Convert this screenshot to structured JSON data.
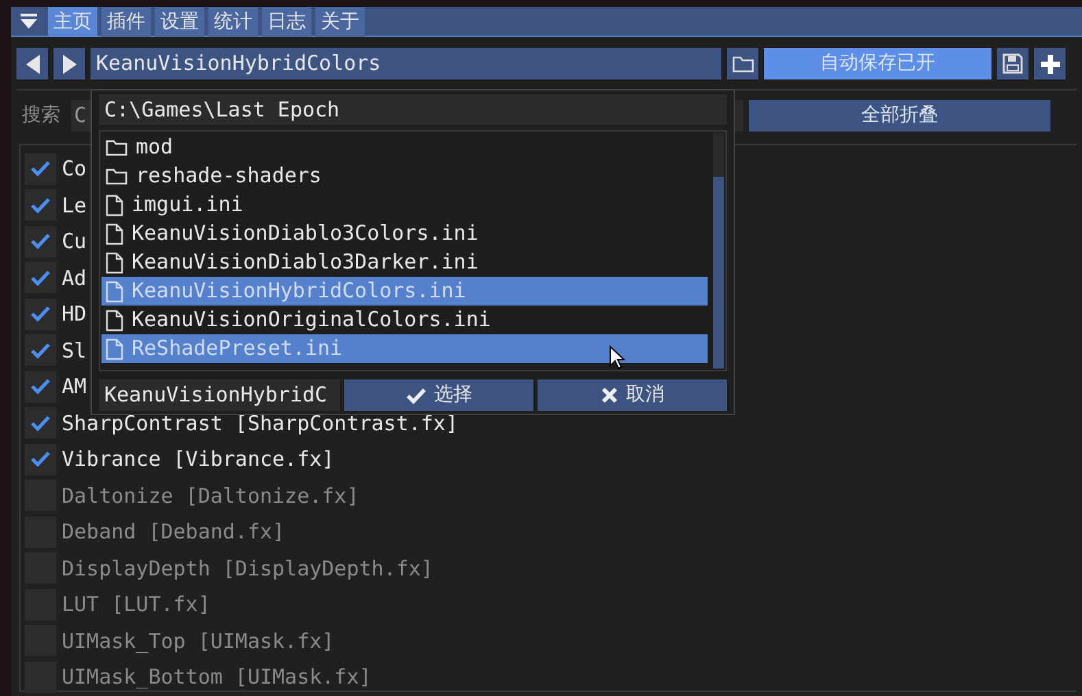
{
  "tabs": [
    {
      "label": "主页",
      "selected": true
    },
    {
      "label": "插件",
      "selected": false
    },
    {
      "label": "设置",
      "selected": false
    },
    {
      "label": "统计",
      "selected": false
    },
    {
      "label": "日志",
      "selected": false
    },
    {
      "label": "关于",
      "selected": false
    }
  ],
  "preset_bar": {
    "preset_name": "KeanuVisionHybridColors",
    "autosave_button": "自动保存已开"
  },
  "search": {
    "label": "搜索",
    "visible_text": "C",
    "collapse_button": "全部折叠"
  },
  "effects": [
    {
      "name": "Co",
      "checked": true
    },
    {
      "name": "Le",
      "checked": true
    },
    {
      "name": "Cu",
      "checked": true
    },
    {
      "name": "Ad",
      "checked": true
    },
    {
      "name": "HD",
      "checked": true
    },
    {
      "name": "Sl",
      "checked": true
    },
    {
      "name": "AM",
      "checked": true
    },
    {
      "name": "SharpContrast [SharpContrast.fx]",
      "checked": true
    },
    {
      "name": "Vibrance [Vibrance.fx]",
      "checked": true
    },
    {
      "name": "Daltonize [Daltonize.fx]",
      "checked": false
    },
    {
      "name": "Deband [Deband.fx]",
      "checked": false
    },
    {
      "name": "DisplayDepth [DisplayDepth.fx]",
      "checked": false
    },
    {
      "name": "LUT [LUT.fx]",
      "checked": false
    },
    {
      "name": "UIMask_Top [UIMask.fx]",
      "checked": false
    },
    {
      "name": "UIMask_Bottom [UIMask.fx]",
      "checked": false
    }
  ],
  "file_dialog": {
    "path": "C:\\Games\\Last Epoch",
    "items": [
      {
        "kind": "folder",
        "name": "mod",
        "selected": false
      },
      {
        "kind": "folder",
        "name": "reshade-shaders",
        "selected": false
      },
      {
        "kind": "file",
        "name": "imgui.ini",
        "selected": false
      },
      {
        "kind": "file",
        "name": "KeanuVisionDiablo3Colors.ini",
        "selected": false
      },
      {
        "kind": "file",
        "name": "KeanuVisionDiablo3Darker.ini",
        "selected": false
      },
      {
        "kind": "file",
        "name": "KeanuVisionHybridColors.ini",
        "selected": true
      },
      {
        "kind": "file",
        "name": "KeanuVisionOriginalColors.ini",
        "selected": false
      },
      {
        "kind": "file",
        "name": "ReShadePreset.ini",
        "selected": true
      }
    ],
    "filename": "KeanuVisionHybridC",
    "select_button": "选择",
    "cancel_button": "取消"
  }
}
